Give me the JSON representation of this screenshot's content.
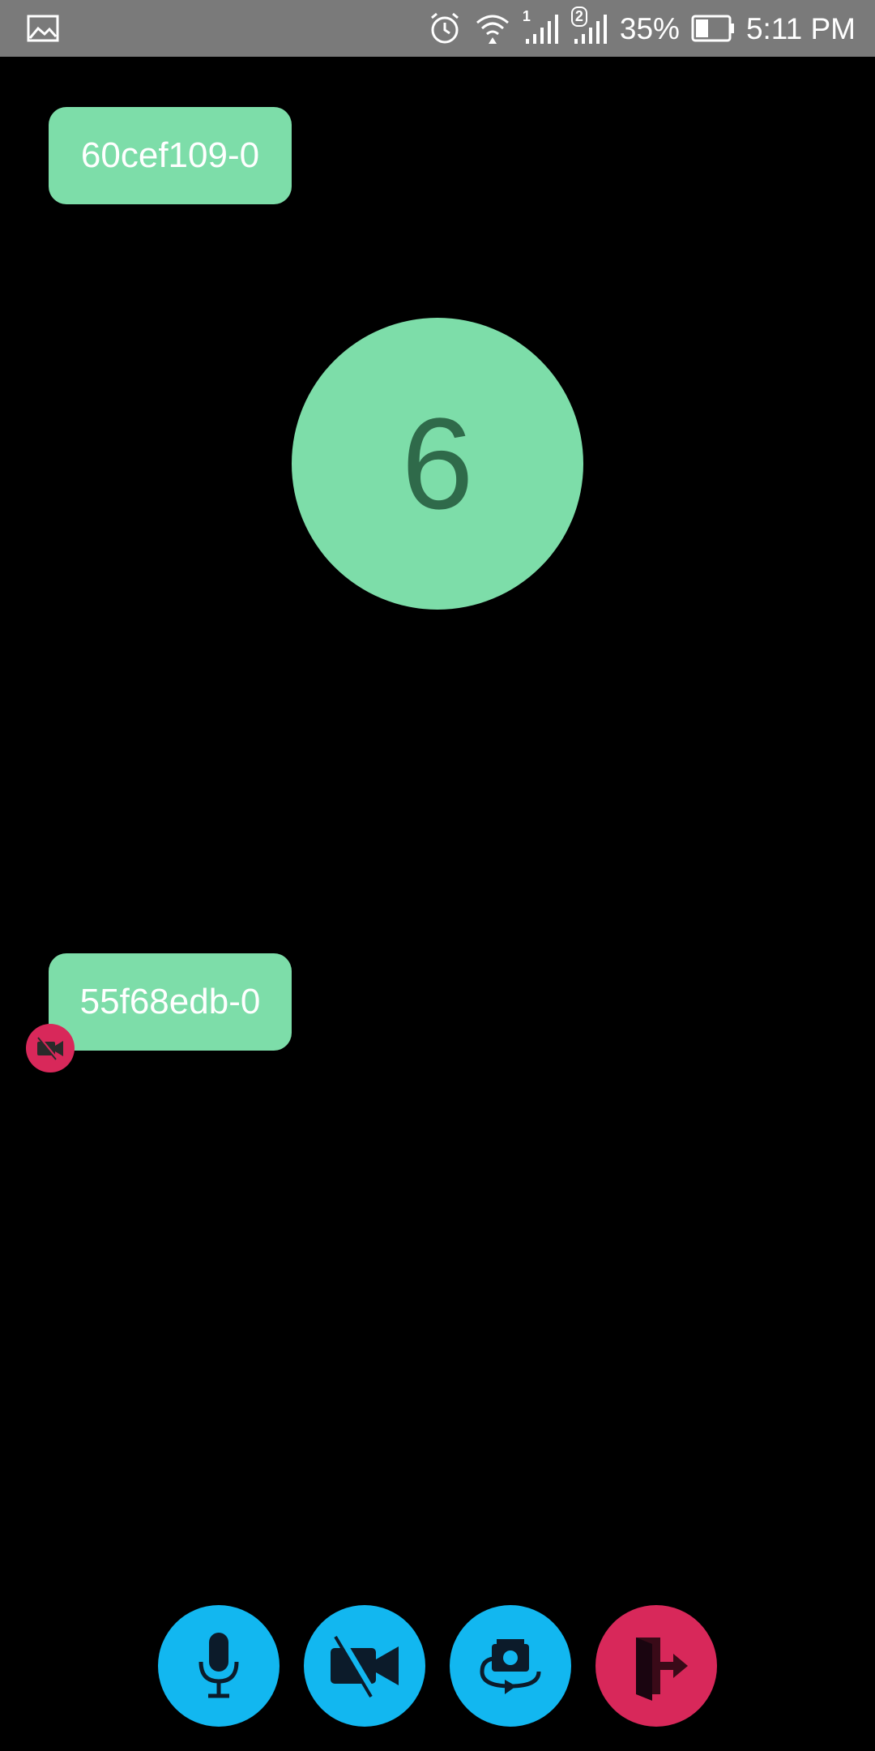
{
  "status_bar": {
    "sim1_label": "1",
    "sim2_label": "2",
    "battery_percent": "35%",
    "time": "5:11 PM",
    "icons": [
      "gallery-icon",
      "alarm-icon",
      "wifi-icon",
      "signal-sim1-icon",
      "signal-sim2-icon",
      "battery-icon"
    ]
  },
  "participants": [
    {
      "label": "60cef109-0"
    },
    {
      "label": "55f68edb-0",
      "camera_off": true
    }
  ],
  "participant_count": "6",
  "controls": {
    "icons": [
      "microphone-icon",
      "video-off-icon",
      "switch-camera-icon",
      "leave-call-icon"
    ]
  },
  "colors": {
    "status_bar": "#7a7a7a",
    "tile": "#7ddda9",
    "count_text": "#2f6a4a",
    "control_blue": "#12b7f0",
    "control_red": "#d8285a",
    "background": "#000000"
  }
}
